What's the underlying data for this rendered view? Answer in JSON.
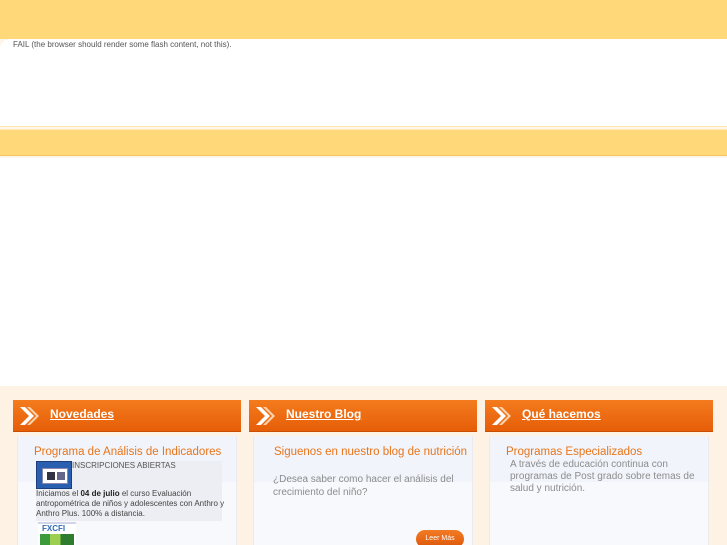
{
  "flash": {
    "fail_text": "FAIL (the browser should render some flash content, not this)."
  },
  "panels": [
    {
      "title": "Novedades",
      "item_title": "Programa de Análisis de Indicadores",
      "badge_text": "INSCRIPCIONES ABIERTAS",
      "text_before": "Iniciamos el ",
      "text_bold": "04 de julio",
      "text_after": " el curso Evaluación antropométrica de niños y adolescentes con Anthro y Anthro Plus. 100% a distancia.",
      "logo_text": "FXCFI"
    },
    {
      "title": "Nuestro Blog",
      "item_title": "Siguenos en nuestro blog de nutrición",
      "description": "¿Desea saber como hacer el análisis del crecimiento del niño?",
      "button_label": "Leer Más"
    },
    {
      "title": "Qué hacemos",
      "item_title": "Programas Especializados",
      "description": "A través de educación continua con programas de Post grado sobre temas de salud y nutrición."
    }
  ],
  "colors": {
    "header_band": "#ffd87a",
    "panel_header": "#f47b1e",
    "accent_text": "#e8751a"
  }
}
